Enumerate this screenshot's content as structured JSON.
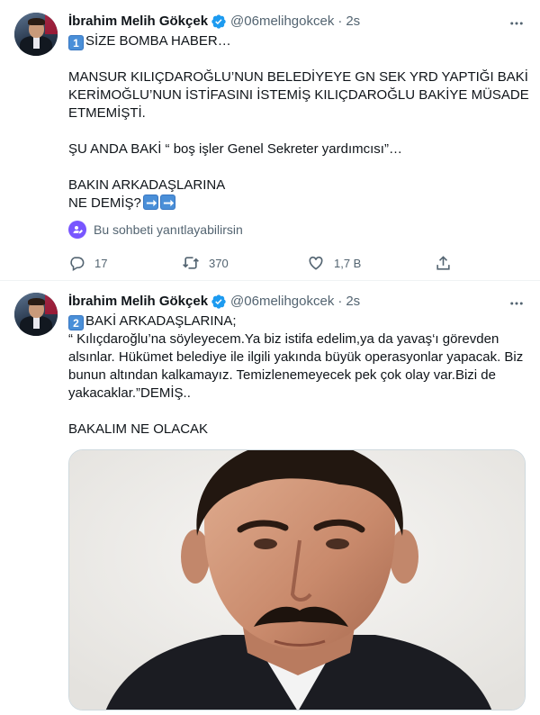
{
  "tweets": [
    {
      "author": {
        "name": "İbrahim Melih Gökçek",
        "handle": "@06melihgokcek",
        "time": "2s",
        "verified": true
      },
      "lines": {
        "l1_num": "1",
        "l1": "SİZE BOMBA HABER…",
        "l2": "MANSUR KILIÇDAROĞLU’NUN BELEDİYEYE GN SEK YRD YAPTIĞI BAKİ",
        "l3": "KERİMOĞLU’NUN İSTİFASINI İSTEMİŞ KILIÇDAROĞLU BAKİYE MÜSADE",
        "l4": "ETMEMİŞTİ.",
        "l5": "ŞU ANDA BAKİ “ boş işler Genel Sekreter yardımcısı”…",
        "l6": "BAKIN ARKADAŞLARINA",
        "l7": "NE DEMİŞ?"
      },
      "reply_restriction": "Bu sohbeti yanıtlayabilirsin",
      "stats": {
        "replies": "17",
        "retweets": "370",
        "likes": "1,7 B"
      }
    },
    {
      "author": {
        "name": "İbrahim Melih Gökçek",
        "handle": "@06melihgokcek",
        "time": "2s",
        "verified": true
      },
      "lines": {
        "l1_num": "2",
        "l1": "BAKİ ARKADAŞLARINA;",
        "l2": "“ Kılıçdaroğlu’na söyleyecem.Ya biz istifa edelim,ya da yavaş‘ı görevden",
        "l3": "alsınlar. Hükümet belediye ile ilgili yakında büyük operasyonlar yapacak. Biz",
        "l4": "bunun altından kalkamayız. Temizlenemeyecek pek çok olay var.Bizi de",
        "l5": "yakacaklar.”DEMİŞ..",
        "l6": "BAKALIM NE OLACAK"
      },
      "media": "portrait-photo"
    }
  ],
  "colors": {
    "verified": "#1d9bf0",
    "secondary_text": "#536471",
    "restrict_icon": "#7856ff",
    "divider": "#eff3f4"
  },
  "icons": [
    "more-icon",
    "verified-icon",
    "reply-icon",
    "retweet-icon",
    "like-icon",
    "share-icon",
    "reply-restrict-icon"
  ]
}
